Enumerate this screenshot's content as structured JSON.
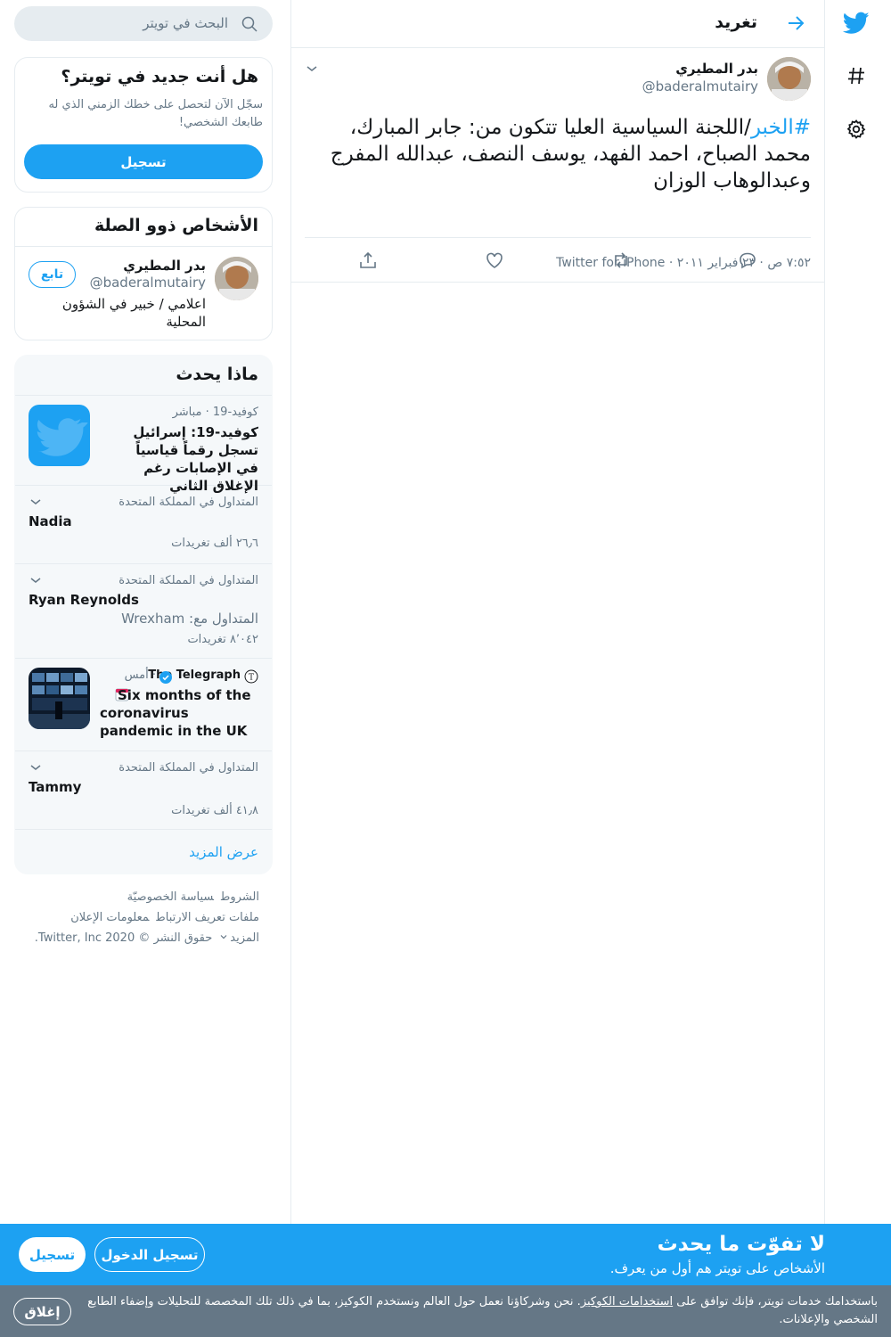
{
  "colors": {
    "accent": "#1da1f2",
    "text": "#14171a",
    "muted": "#657786",
    "border": "#e6ecf0",
    "cookie_bg": "#657786"
  },
  "nav": {
    "icons": [
      "twitter-logo-icon",
      "hashtag-icon",
      "gear-icon"
    ]
  },
  "header": {
    "title": "تغريد"
  },
  "tweet": {
    "name": "بدر المطيري",
    "handle": "@baderalmutairy",
    "hashtag": "#الخبر",
    "text": "/اللجنة السياسية العليا تتكون من: جابر المبارك، محمد الصباح، احمد الفهد، يوسف النصف، عبدالله المفرج وعبدالوهاب الوزان",
    "meta": "٧:٥٢ ص · ٢٣ فبراير ٢٠١١ · Twitter for iPhone",
    "actions": [
      "reply-icon",
      "retweet-icon",
      "like-icon",
      "share-icon"
    ]
  },
  "search": {
    "placeholder": "البحث في تويتر"
  },
  "new_card": {
    "title": "هل أنت جديد في تويتر؟",
    "subtitle": "سجّل الآن لتحصل على خطك الزمني الذي له طابعك الشخصي!",
    "button": "تسجيل"
  },
  "related": {
    "title": "الأشخاص ذوو الصلة",
    "name": "بدر المطيري",
    "handle": "@baderalmutairy",
    "bio": "اعلامي / خبير في الشؤون المحلية",
    "follow": "تابع"
  },
  "trends": {
    "title": "ماذا يحدث",
    "news1": {
      "context": "كوفيد-19 · مباشر",
      "title": "كوفيد-19: إسرائيل تسجل رقماً قياسياً في الإصابات رغم الإغلاق الثاني"
    },
    "trend1": {
      "context": "المتداول في المملكة المتحدة",
      "name": "Nadia",
      "count": "٢٦٫٦ ألف تغريدات"
    },
    "trend2": {
      "context": "المتداول في المملكة المتحدة",
      "name": "Ryan Reynolds",
      "with": "المتداول مع: Wrexham",
      "count": "٨٬٠٤٢ تغريدات"
    },
    "news2": {
      "source": "The Telegraph",
      "time": "· أمس",
      "title": "Six months of the coronavirus pandemic in the UK"
    },
    "trend3": {
      "context": "المتداول في المملكة المتحدة",
      "name": "Tammy",
      "count": "٤١٫٨ ألف تغريدات"
    },
    "more": "عرض المزيد"
  },
  "footer": {
    "terms": "الشروط",
    "privacy": "سياسة الخصوصيّة",
    "cookies": "ملفات تعريف الارتباط",
    "ads": "معلومات الإعلان",
    "more": "المزيد",
    "copyright": "حقوق النشر © 2020 Twitter, Inc."
  },
  "signup_bar": {
    "heading": "لا تفوّت ما يحدث",
    "subheading": "الأشخاص على تويتر هم أول من يعرف.",
    "login": "تسجيل الدخول",
    "signup": "تسجيل"
  },
  "cookie_bar": {
    "text_before": "باستخدامك خدمات تويتر، فإنك توافق على ",
    "link": "استخدامات الكوكيز",
    "text_after": ". نحن وشركاؤنا نعمل حول العالم ونستخدم الكوكيز، بما في ذلك تلك المخصصة للتحليلات وإضفاء الطابع الشخصي والإعلانات.",
    "close": "إغلاق"
  }
}
